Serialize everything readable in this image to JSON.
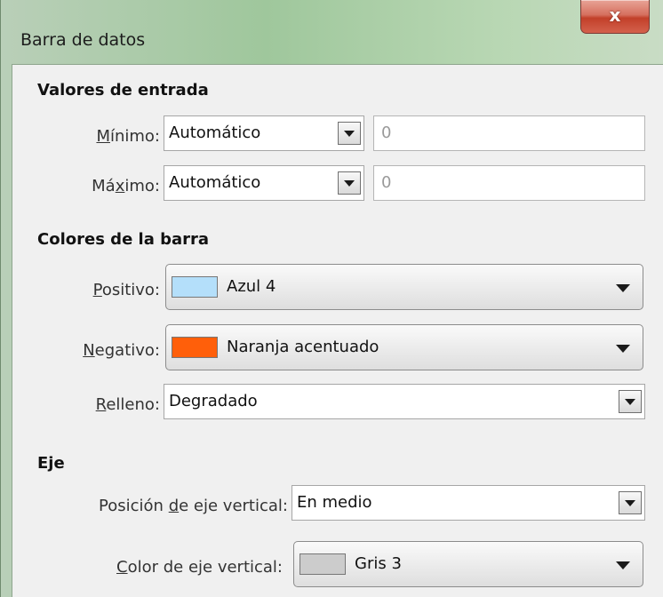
{
  "window": {
    "title": "Barra de datos",
    "close_label": "x"
  },
  "entry_values": {
    "heading": "Valores de entrada",
    "minimum": {
      "label_pre": "",
      "label_access": "M",
      "label_post": "ínimo:",
      "mode": "Automático",
      "value": "0"
    },
    "maximum": {
      "label_pre": "Má",
      "label_access": "x",
      "label_post": "imo:",
      "mode": "Automático",
      "value": "0"
    }
  },
  "bar_colors": {
    "heading": "Colores de la barra",
    "positive": {
      "label_pre": "",
      "label_access": "P",
      "label_post": "ositivo:",
      "color_name": "Azul 4",
      "swatch": "#b4dffa"
    },
    "negative": {
      "label_pre": "",
      "label_access": "N",
      "label_post": "egativo:",
      "color_name": "Naranja acentuado",
      "swatch": "#ff5f0a"
    },
    "fill": {
      "label_pre": "",
      "label_access": "R",
      "label_post": "elleno:",
      "value": "Degradado"
    }
  },
  "axis": {
    "heading": "Eje",
    "position": {
      "label_pre": "Posición ",
      "label_access": "d",
      "label_post": "e eje vertical:",
      "value": "En medio"
    },
    "color": {
      "label_pre": "",
      "label_access": "C",
      "label_post": "olor de eje vertical:",
      "color_name": "Gris 3",
      "swatch": "#cccccc"
    }
  }
}
